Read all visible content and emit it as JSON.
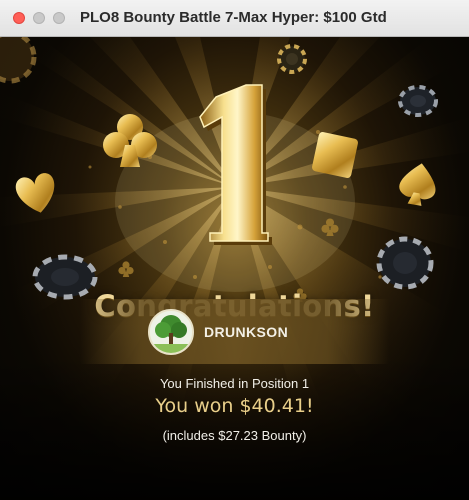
{
  "window": {
    "title": "PLO8 Bounty Battle 7-Max Hyper: $100 Gtd"
  },
  "hero": {
    "place_number": "1",
    "congrats": "Congratulations!"
  },
  "player": {
    "name": "DRUNKSON",
    "avatar_icon": "tree-avatar-icon"
  },
  "result": {
    "finish_text": "You Finished in Position 1",
    "won_text": "You won $40.41!",
    "bounty_text": "(includes $27.23 Bounty)"
  },
  "colors": {
    "gold": "#e9cf8a",
    "background": "#050403"
  }
}
